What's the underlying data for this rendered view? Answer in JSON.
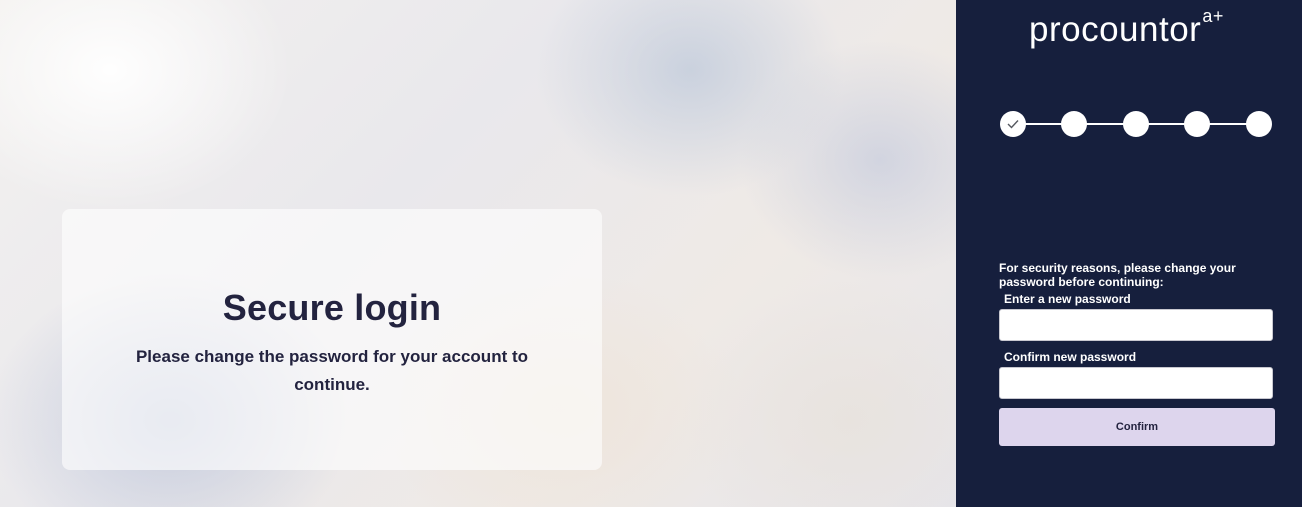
{
  "info": {
    "title": "Secure login",
    "message": "Please change the password for your account to continue."
  },
  "brand": {
    "logo_text": "procountor",
    "logo_superscript": "a+"
  },
  "steps": {
    "total": 5,
    "completed": 1,
    "completed_icon": "check-icon"
  },
  "form": {
    "intro": "For security reasons, please change your password before continuing:",
    "new_password_label": "Enter a new password",
    "new_password_value": "",
    "confirm_password_label": "Confirm new password",
    "confirm_password_value": "",
    "confirm_button": "Confirm"
  },
  "colors": {
    "panel_bg": "#161f3d",
    "button_bg": "#ddd5ed",
    "text_dark": "#23233f"
  }
}
